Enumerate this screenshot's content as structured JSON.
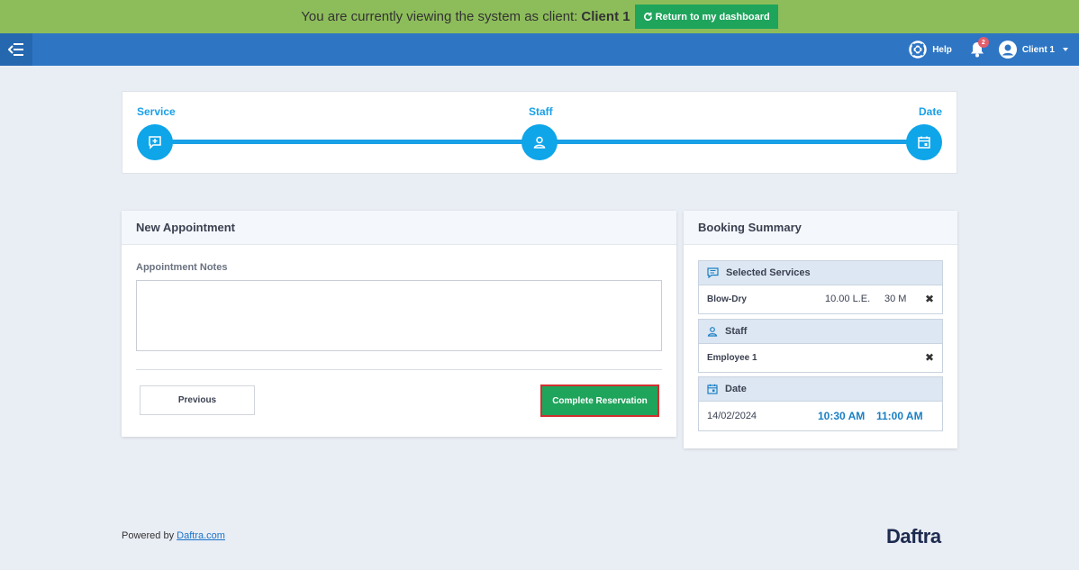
{
  "impersonation": {
    "message": "You are currently viewing the system as client:",
    "client_name": "Client 1",
    "return_label": "Return to my dashboard"
  },
  "topbar": {
    "help_label": "Help",
    "notification_count": "2",
    "user_name": "Client 1"
  },
  "steps": [
    {
      "label": "Service",
      "icon": "service-icon"
    },
    {
      "label": "Staff",
      "icon": "user-icon"
    },
    {
      "label": "Date",
      "icon": "calendar-icon"
    }
  ],
  "appointment": {
    "title": "New Appointment",
    "notes_label": "Appointment Notes",
    "notes_value": "",
    "previous_label": "Previous",
    "complete_label": "Complete Reservation"
  },
  "summary": {
    "title": "Booking Summary",
    "services_title": "Selected Services",
    "service": {
      "name": "Blow-Dry",
      "price": "10.00 L.E.",
      "duration": "30 M"
    },
    "staff_title": "Staff",
    "staff_name": "Employee 1",
    "date_title": "Date",
    "date": "14/02/2024",
    "time_start": "10:30 AM",
    "time_end": "11:00 AM",
    "remove_symbol": "✖"
  },
  "footer": {
    "powered_by": "Powered by",
    "link_text": "Daftra.com",
    "brand": "Daftra"
  },
  "colors": {
    "impersonation_bg": "#8dbd5b",
    "topbar_bg": "#2e76c4",
    "step_accent": "#0ea5e9",
    "primary_green": "#1fa45c",
    "highlight_border": "#d32f2f"
  }
}
